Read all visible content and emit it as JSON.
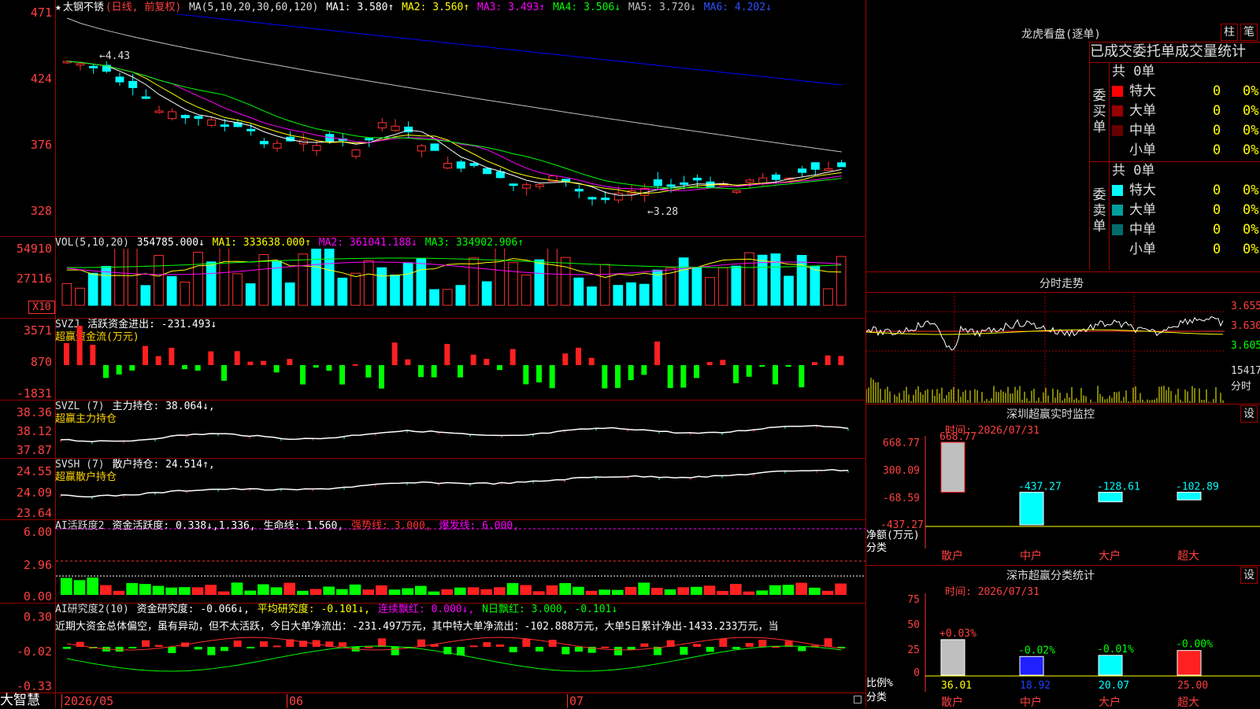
{
  "app": {
    "brand": "大智慧"
  },
  "kline": {
    "header_star": "★",
    "stock_name": "太钢不锈",
    "mode": "(日线, 前复权)",
    "ma_params": "MA(5,10,20,30,60,120)",
    "ma1": "MA1: 3.580↑",
    "ma2": "MA2: 3.560↑",
    "ma3": "MA3: 3.493↑",
    "ma4": "MA4: 3.506↓",
    "ma5": "MA5: 3.720↓",
    "ma6": "MA6: 4.202↓",
    "y_ticks": [
      "471",
      "424",
      "376",
      "328"
    ],
    "high_label": "4.43",
    "low_label": "3.28",
    "colors": {
      "ma1": "#ffffff",
      "ma2": "#ffff00",
      "ma3": "#ff00ff",
      "ma4": "#00ff00",
      "ma5": "#c0c0c0",
      "ma6": "#0000ff"
    }
  },
  "volume": {
    "title": "VOL(5,10,20)",
    "value": "354785.000↓",
    "ma1": "MA1: 333638.000↑",
    "ma2": "MA2: 361041.188↓",
    "ma3": "MA3: 334902.906↑",
    "y_ticks": [
      "54910",
      "27116"
    ],
    "unit": "X10"
  },
  "svzj": {
    "title": "SVZJ",
    "label": "活跃资金进出: -231.493↓",
    "sub": "超赢资金流(万元)",
    "y_ticks": [
      "3571",
      "870",
      "-1831"
    ]
  },
  "svzl": {
    "title": "SVZL (7)",
    "label": "主力持仓: 38.064↓,",
    "sub": "超赢主力持仓",
    "y_ticks": [
      "38.36",
      "38.12",
      "37.87"
    ]
  },
  "svsh": {
    "title": "SVSH (7)",
    "label": "散户持仓: 24.514↑,",
    "sub": "超赢散户持仓",
    "y_ticks": [
      "24.55",
      "24.09",
      "23.64"
    ]
  },
  "ai_active": {
    "title": "AI活跃度2",
    "label": "资金活跃度: 0.338↓,1.336,",
    "life": "生命线: 1.560,",
    "strong": "强势线: 3.000,",
    "burst": "爆发线: 6.000,",
    "y_ticks": [
      "6.00",
      "2.96",
      "0.00"
    ]
  },
  "ai_research": {
    "title": "AI研究度2(10)",
    "label": "资金研究度: -0.066↓,",
    "avg": "平均研究度: -0.101↓,",
    "streak": "连续飘红: 0.000↓,",
    "nday": "N日飘红: 3.000, -0.101↓",
    "summary": "近期大资金总体偏空，虽有异动，但不太活跃，今日大单净流出：-231.497万元，其中特大单净流出：-102.888万元，大单5日累计净出-1433.233万元，当",
    "y_ticks": [
      "0.30",
      "-0.02",
      "-0.33"
    ]
  },
  "dates": {
    "d1": "2026/05",
    "d2": "06",
    "d3": "07"
  },
  "dragon": {
    "title": "龙虎看盘(逐单)",
    "btn_bar": "柱",
    "btn_pen": "笔",
    "tabs": [
      "已成交",
      "委托单",
      "成交量统计"
    ],
    "buy_side_label": "委买单",
    "sell_side_label": "委卖单",
    "buy_total": "共 0单",
    "sell_total": "共 0单",
    "buy_rows": [
      {
        "name": "特大",
        "count": "0",
        "pct": "0%",
        "color": "#ff0000"
      },
      {
        "name": "大单",
        "count": "0",
        "pct": "0%",
        "color": "#990000"
      },
      {
        "name": "中单",
        "count": "0",
        "pct": "0%",
        "color": "#660000"
      },
      {
        "name": "小单",
        "count": "0",
        "pct": "0%",
        "color": "#000000"
      }
    ],
    "sell_rows": [
      {
        "name": "特大",
        "count": "0",
        "pct": "0%",
        "color": "#00ffff"
      },
      {
        "name": "大单",
        "count": "0",
        "pct": "0%",
        "color": "#00a0a0"
      },
      {
        "name": "中单",
        "count": "0",
        "pct": "0%",
        "color": "#006c6c"
      },
      {
        "name": "小单",
        "count": "0",
        "pct": "0%",
        "color": "#000000"
      }
    ]
  },
  "intraday": {
    "title": "分时走势",
    "prices": [
      "3.655",
      "3.630",
      "3.605"
    ],
    "volume": "15417",
    "vol_label": "分时"
  },
  "monitor": {
    "title": "深圳超赢实时监控",
    "btn": "设",
    "time": "时间: 2026/07/31",
    "y_ticks": [
      "668.77",
      "300.09",
      "-68.59",
      "-437.27"
    ],
    "ylabel": "净额(万元)",
    "xlabel": "分类",
    "categories": [
      "散户",
      "中户",
      "大户",
      "超大"
    ],
    "values": [
      "668.77",
      "-437.27",
      "-128.61",
      "-102.89"
    ],
    "nums": [
      668.77,
      -437.27,
      -128.61,
      -102.89
    ]
  },
  "stats": {
    "title": "深市超赢分类统计",
    "btn": "设",
    "time": "时间: 2026/07/31",
    "y_ticks": [
      "75",
      "50",
      "25",
      "0"
    ],
    "ylabel": "比例%",
    "xlabel": "分类",
    "categories": [
      "散户",
      "中户",
      "大户",
      "超大"
    ],
    "changes": [
      "+0.03%",
      "-0.02%",
      "-0.01%",
      "-0.00%"
    ],
    "values": [
      "36.01",
      "18.92",
      "20.07",
      "25.00"
    ],
    "nums": [
      36.01,
      18.92,
      20.07,
      25.0
    ]
  },
  "chart_data": [
    {
      "type": "bar",
      "title": "深圳超赢实时监控",
      "categories": [
        "散户",
        "中户",
        "大户",
        "超大"
      ],
      "values": [
        668.77,
        -437.27,
        -128.61,
        -102.89
      ],
      "ylabel": "净额(万元)",
      "ylim": [
        -437.27,
        668.77
      ]
    },
    {
      "type": "bar",
      "title": "深市超赢分类统计",
      "categories": [
        "散户",
        "中户",
        "大户",
        "超大"
      ],
      "values": [
        36.01,
        18.92,
        20.07,
        25.0
      ],
      "ylabel": "比例%",
      "ylim": [
        0,
        75
      ]
    }
  ]
}
